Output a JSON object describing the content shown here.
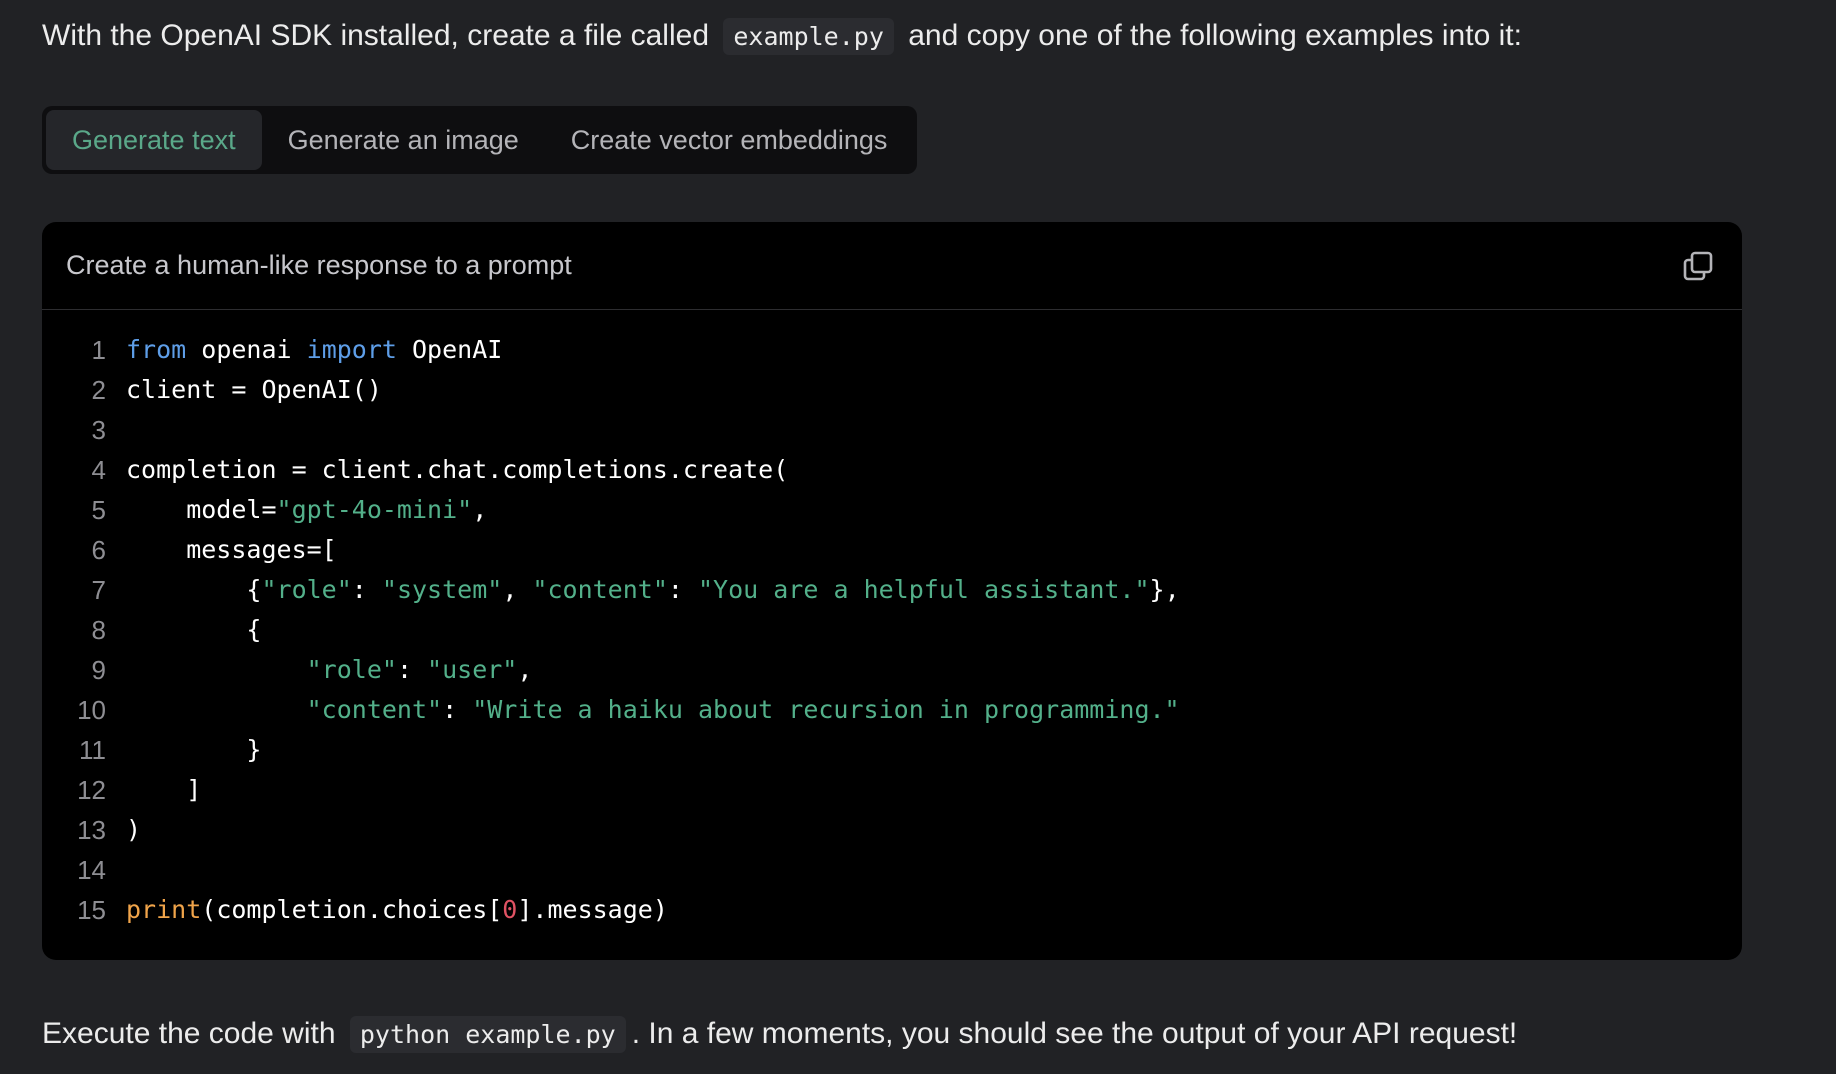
{
  "intro": {
    "before": "With the OpenAI SDK installed, create a file called",
    "code": "example.py",
    "after": "and copy one of the following examples into it:"
  },
  "tabs": [
    {
      "label": "Generate text",
      "active": true
    },
    {
      "label": "Generate an image",
      "active": false
    },
    {
      "label": "Create vector embeddings",
      "active": false
    }
  ],
  "code_block": {
    "title": "Create a human-like response to a prompt",
    "copy_icon": "copy-icon",
    "lines": [
      {
        "n": "1",
        "tokens": [
          {
            "t": "from",
            "c": "kw"
          },
          {
            "t": " openai ",
            "c": "plain"
          },
          {
            "t": "import",
            "c": "kw"
          },
          {
            "t": " OpenAI",
            "c": "plain"
          }
        ]
      },
      {
        "n": "2",
        "tokens": [
          {
            "t": "client = OpenAI()",
            "c": "plain"
          }
        ]
      },
      {
        "n": "3",
        "tokens": []
      },
      {
        "n": "4",
        "tokens": [
          {
            "t": "completion = client.chat.completions.create(",
            "c": "plain"
          }
        ]
      },
      {
        "n": "5",
        "tokens": [
          {
            "t": "    model=",
            "c": "plain"
          },
          {
            "t": "\"gpt-4o-mini\"",
            "c": "str"
          },
          {
            "t": ",",
            "c": "plain"
          }
        ]
      },
      {
        "n": "6",
        "tokens": [
          {
            "t": "    messages=[",
            "c": "plain"
          }
        ]
      },
      {
        "n": "7",
        "tokens": [
          {
            "t": "        {",
            "c": "plain"
          },
          {
            "t": "\"role\"",
            "c": "str"
          },
          {
            "t": ": ",
            "c": "plain"
          },
          {
            "t": "\"system\"",
            "c": "str"
          },
          {
            "t": ", ",
            "c": "plain"
          },
          {
            "t": "\"content\"",
            "c": "str"
          },
          {
            "t": ": ",
            "c": "plain"
          },
          {
            "t": "\"You are a helpful assistant.\"",
            "c": "str"
          },
          {
            "t": "},",
            "c": "plain"
          }
        ]
      },
      {
        "n": "8",
        "tokens": [
          {
            "t": "        {",
            "c": "plain"
          }
        ]
      },
      {
        "n": "9",
        "tokens": [
          {
            "t": "            ",
            "c": "plain"
          },
          {
            "t": "\"role\"",
            "c": "str"
          },
          {
            "t": ": ",
            "c": "plain"
          },
          {
            "t": "\"user\"",
            "c": "str"
          },
          {
            "t": ",",
            "c": "plain"
          }
        ]
      },
      {
        "n": "10",
        "tokens": [
          {
            "t": "            ",
            "c": "plain"
          },
          {
            "t": "\"content\"",
            "c": "str"
          },
          {
            "t": ": ",
            "c": "plain"
          },
          {
            "t": "\"Write a haiku about recursion in programming.\"",
            "c": "str"
          }
        ]
      },
      {
        "n": "11",
        "tokens": [
          {
            "t": "        }",
            "c": "plain"
          }
        ]
      },
      {
        "n": "12",
        "tokens": [
          {
            "t": "    ]",
            "c": "plain"
          }
        ]
      },
      {
        "n": "13",
        "tokens": [
          {
            "t": ")",
            "c": "plain"
          }
        ]
      },
      {
        "n": "14",
        "tokens": []
      },
      {
        "n": "15",
        "tokens": [
          {
            "t": "print",
            "c": "fn"
          },
          {
            "t": "(completion.choices[",
            "c": "plain"
          },
          {
            "t": "0",
            "c": "num"
          },
          {
            "t": "].message)",
            "c": "plain"
          }
        ]
      }
    ]
  },
  "outro": {
    "before": "Execute the code with",
    "code": "python example.py",
    "after": ". In a few moments, you should see the output of your API request!"
  }
}
